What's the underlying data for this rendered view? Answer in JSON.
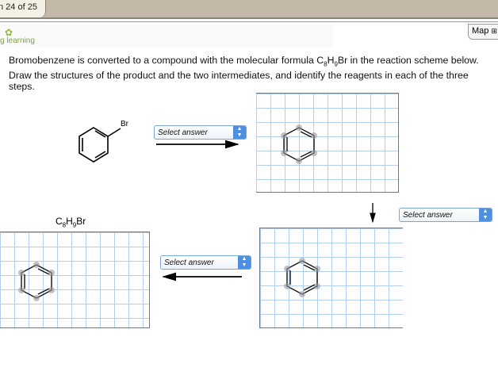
{
  "header": {
    "tab_label": "n 24 of 25",
    "map_label": "Map"
  },
  "logo": {
    "text": "g learning"
  },
  "question": {
    "text_before": "Bromobenzene is converted to a compound with the molecular formula C",
    "sub1": "8",
    "mid": "H",
    "sub2": "9",
    "text_after": "Br in the reaction scheme below. Draw the structures of the product and the two intermediates, and identify the reagents in each of the three steps."
  },
  "start": {
    "substituent": "Br"
  },
  "product": {
    "c": "C",
    "c_sub": "8",
    "h": "H",
    "h_sub": "9",
    "br": "Br"
  },
  "dropdowns": [
    {
      "value": "Select answer"
    },
    {
      "value": "Select answer"
    },
    {
      "value": "Select answer"
    }
  ]
}
